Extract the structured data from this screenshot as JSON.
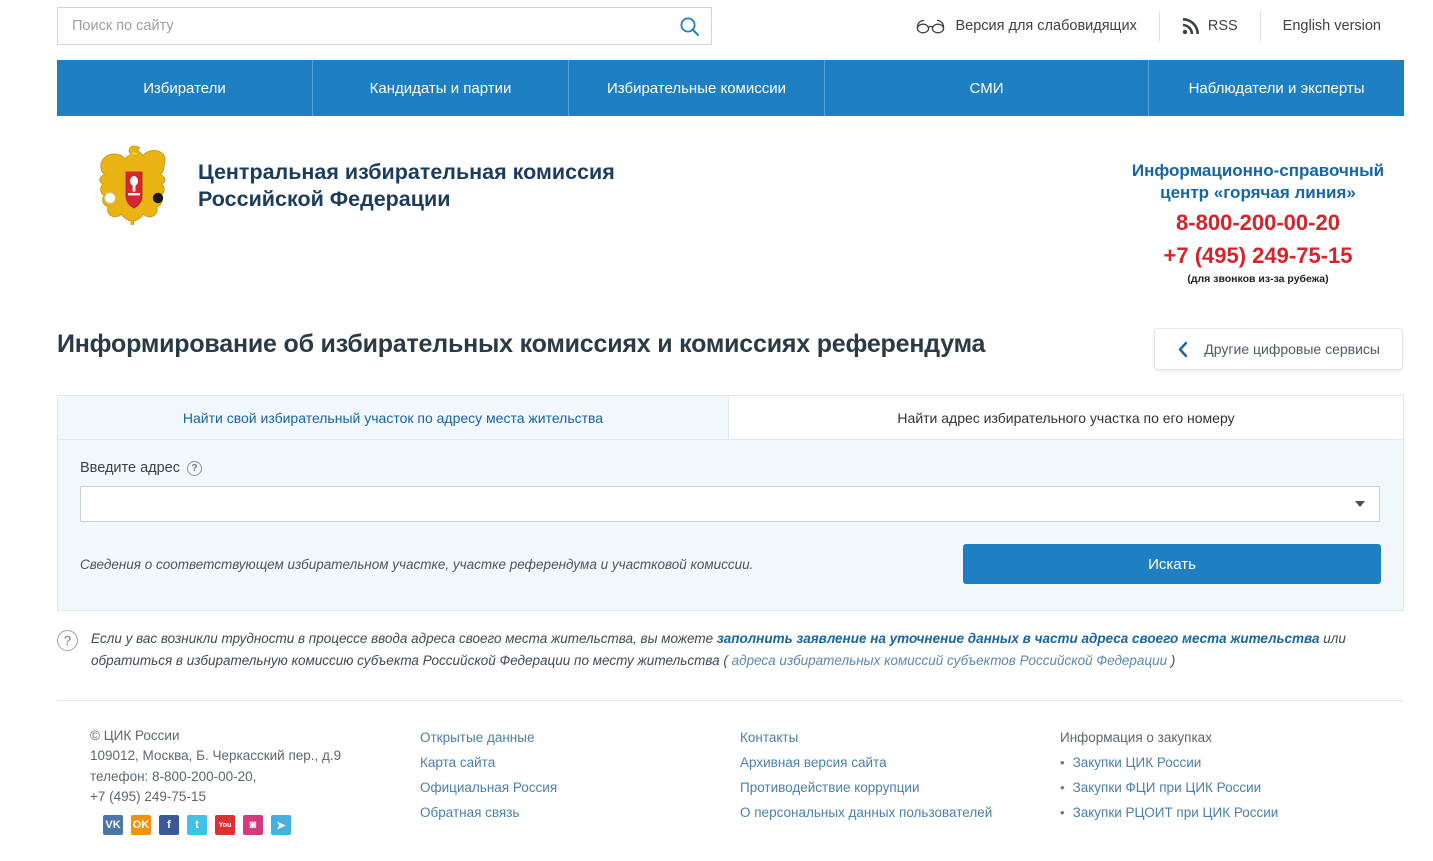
{
  "search": {
    "placeholder": "Поиск по сайту",
    "value": "",
    "icon": "search-icon"
  },
  "top_links": [
    {
      "label": "Версия для слабовидящих",
      "icon": "glasses-icon"
    },
    {
      "label": "RSS",
      "icon": "rss-icon"
    },
    {
      "label": "English version",
      "icon": ""
    }
  ],
  "nav": [
    {
      "label": "Избиратели"
    },
    {
      "label": "Кандидаты и партии"
    },
    {
      "label": "Избирательные комиссии"
    },
    {
      "label": "СМИ"
    },
    {
      "label": "Наблюдатели и эксперты"
    }
  ],
  "brand": {
    "title": "Центральная избирательная комиссия\nРоссийской Федерации",
    "emblem": "russian-coat-of-arms-icon"
  },
  "hotline": {
    "title": "Информационно-справочный\nцентр «горячая линия»",
    "phone_main": "8-800-200-00-20",
    "phone_intl": "+7 (495) 249-75-15",
    "note": "(для звонков из-за рубежа)"
  },
  "page": {
    "title": "Информирование об избирательных комиссиях и комиссиях референдума",
    "services_button": "Другие цифровые сервисы"
  },
  "tabs": [
    {
      "label": "Найти свой избирательный участок по адресу места жительства",
      "active": true
    },
    {
      "label": "Найти адрес избирательного участка по его номеру",
      "active": false
    }
  ],
  "form": {
    "address_label": "Введите адрес",
    "address_value": "",
    "hint": "Сведения о соответствующем избирательном участке, участке референдума и участковой комиссии.",
    "submit_label": "Искать"
  },
  "note": {
    "part1": "Если у вас возникли трудности в процессе ввода адреса своего места жительства, вы можете ",
    "link1": "заполнить заявление на уточнение данных в части адреса своего места жительства",
    "part2": " или обратиться в избирательную комиссию субъекта Российской Федерации по месту жительства ( ",
    "link2": "адреса избирательных комиссий субъектов Российской Федерации",
    "part3": " )"
  },
  "footer": {
    "contact": [
      "© ЦИК России",
      "109012, Москва, Б. Черкасский пер., д.9",
      "телефон: 8-800-200-00-20,",
      "+7 (495) 249-75-15"
    ],
    "col1": [
      "Открытые данные",
      "Карта сайта",
      "Официальная Россия",
      "Обратная связь"
    ],
    "col2": [
      "Контакты",
      "Архивная версия сайта",
      "Противодействие коррупции",
      "О персональных данных пользователей"
    ],
    "col3_head": "Информация о закупках",
    "col3": [
      "Закупки ЦИК России",
      "Закупки ФЦИ при ЦИК России",
      "Закупки РЦОИТ при ЦИК России"
    ],
    "socials": [
      {
        "name": "vk",
        "label": "VK",
        "color": "#4a76a8"
      },
      {
        "name": "odnoklassniki",
        "label": "OK",
        "color": "#f2920a"
      },
      {
        "name": "facebook",
        "label": "f",
        "color": "#3b5998"
      },
      {
        "name": "twitter",
        "label": "t",
        "color": "#3ec2e8"
      },
      {
        "name": "youtube",
        "label": "You",
        "color": "#e02f2f"
      },
      {
        "name": "instagram",
        "label": "◙",
        "color": "#d6397e"
      },
      {
        "name": "telegram",
        "label": "➤",
        "color": "#45b0e3"
      }
    ]
  },
  "colors": {
    "accent_blue": "#1e7fc2",
    "link_blue": "#4a7fae",
    "brand_navy": "#1b3c5e",
    "hotline_red": "#d8232a"
  }
}
